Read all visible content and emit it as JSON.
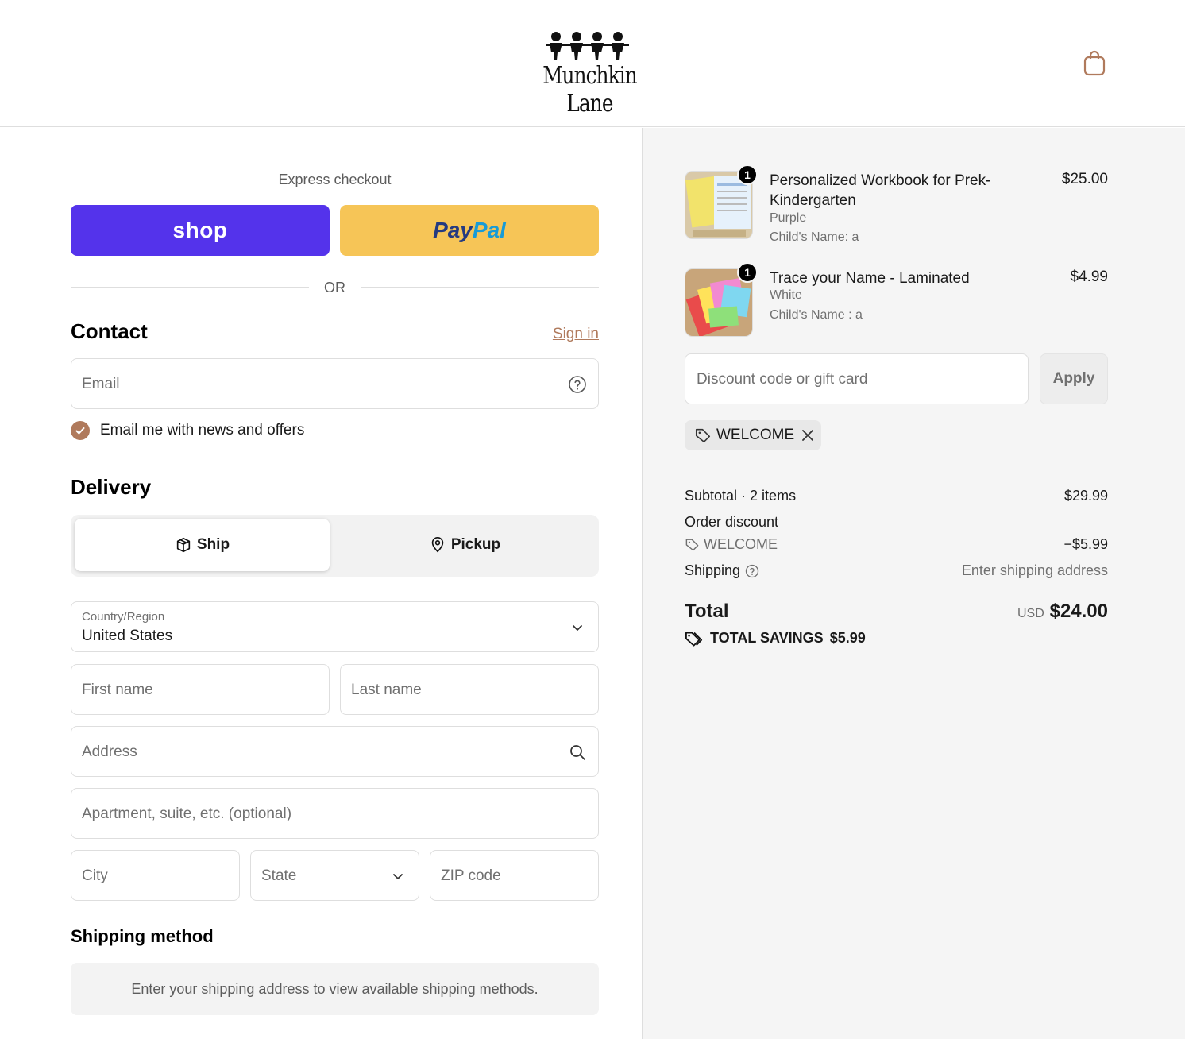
{
  "header": {
    "logo_text": "Munchkin Lane"
  },
  "express": {
    "label": "Express checkout",
    "shop_label": "shop",
    "paypal_part1": "Pay",
    "paypal_part2": "Pal",
    "or_label": "OR"
  },
  "contact": {
    "title": "Contact",
    "sign_in": "Sign in",
    "email_placeholder": "Email",
    "news_label": "Email me with news and offers",
    "news_checked": true
  },
  "delivery": {
    "title": "Delivery",
    "tab_ship": "Ship",
    "tab_pickup": "Pickup",
    "country_label": "Country/Region",
    "country_value": "United States",
    "first_name": "First name",
    "last_name": "Last name",
    "address": "Address",
    "apartment": "Apartment, suite, etc. (optional)",
    "city": "City",
    "state": "State",
    "zip": "ZIP code"
  },
  "shipping_method": {
    "title": "Shipping method",
    "note": "Enter your shipping address to view available shipping methods."
  },
  "cart": {
    "items": [
      {
        "title": "Personalized Workbook for Prek-Kindergarten",
        "variant": "Purple",
        "option": "Child's Name: a",
        "quantity": "1",
        "price": "$25.00"
      },
      {
        "title": "Trace your Name - Laminated",
        "variant": "White",
        "option": "Child's Name : a",
        "quantity": "1",
        "price": "$4.99"
      }
    ],
    "discount_placeholder": "Discount code or gift card",
    "apply_label": "Apply",
    "applied_code": "WELCOME"
  },
  "summary": {
    "subtotal_label": "Subtotal · 2 items",
    "subtotal_value": "$29.99",
    "order_discount_label": "Order discount",
    "discount_code": "WELCOME",
    "discount_value": "−$5.99",
    "shipping_label": "Shipping",
    "shipping_value": "Enter shipping address",
    "total_label": "Total",
    "currency": "USD",
    "total_value": "$24.00",
    "savings_label": "TOTAL SAVINGS",
    "savings_value": "$5.99"
  },
  "colors": {
    "shop_purple": "#5433eb",
    "paypal_yellow": "#f6c557",
    "accent_brown": "#b07a5c"
  }
}
